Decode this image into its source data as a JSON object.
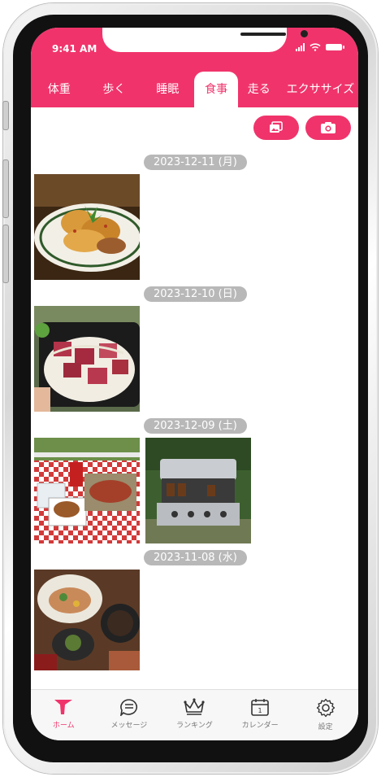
{
  "status_bar": {
    "time": "9:41 AM"
  },
  "tabs": [
    {
      "label": "体重",
      "active": false
    },
    {
      "label": "歩く",
      "active": false
    },
    {
      "label": "睡眠",
      "active": false
    },
    {
      "label": "食事",
      "active": true
    },
    {
      "label": "走る",
      "active": false
    },
    {
      "label": "エクササイズ",
      "active": false
    }
  ],
  "actions": {
    "gallery_icon": "image-stack-icon",
    "camera_icon": "camera-icon"
  },
  "days": [
    {
      "date": "2023-12-11 (月)",
      "photos": [
        "fried-chicken-plate"
      ]
    },
    {
      "date": "2023-12-10 (日)",
      "photos": [
        "poke-bowl"
      ]
    },
    {
      "date": "2023-12-09 (土)",
      "photos": [
        "picnic-table-food",
        "bbq-grill"
      ]
    },
    {
      "date": "2023-11-08 (水)",
      "photos": [
        "japanese-set-meal"
      ]
    }
  ],
  "bottom_nav": [
    {
      "label": "ホーム",
      "icon": "home-arrow-icon",
      "active": true
    },
    {
      "label": "メッセージ",
      "icon": "message-icon",
      "active": false
    },
    {
      "label": "ランキング",
      "icon": "crown-icon",
      "active": false
    },
    {
      "label": "カレンダー",
      "icon": "calendar-icon",
      "active": false
    },
    {
      "label": "設定",
      "icon": "gear-icon",
      "active": false
    }
  ],
  "colors": {
    "accent": "#f0346b",
    "date_pill": "#b8b8b8"
  }
}
